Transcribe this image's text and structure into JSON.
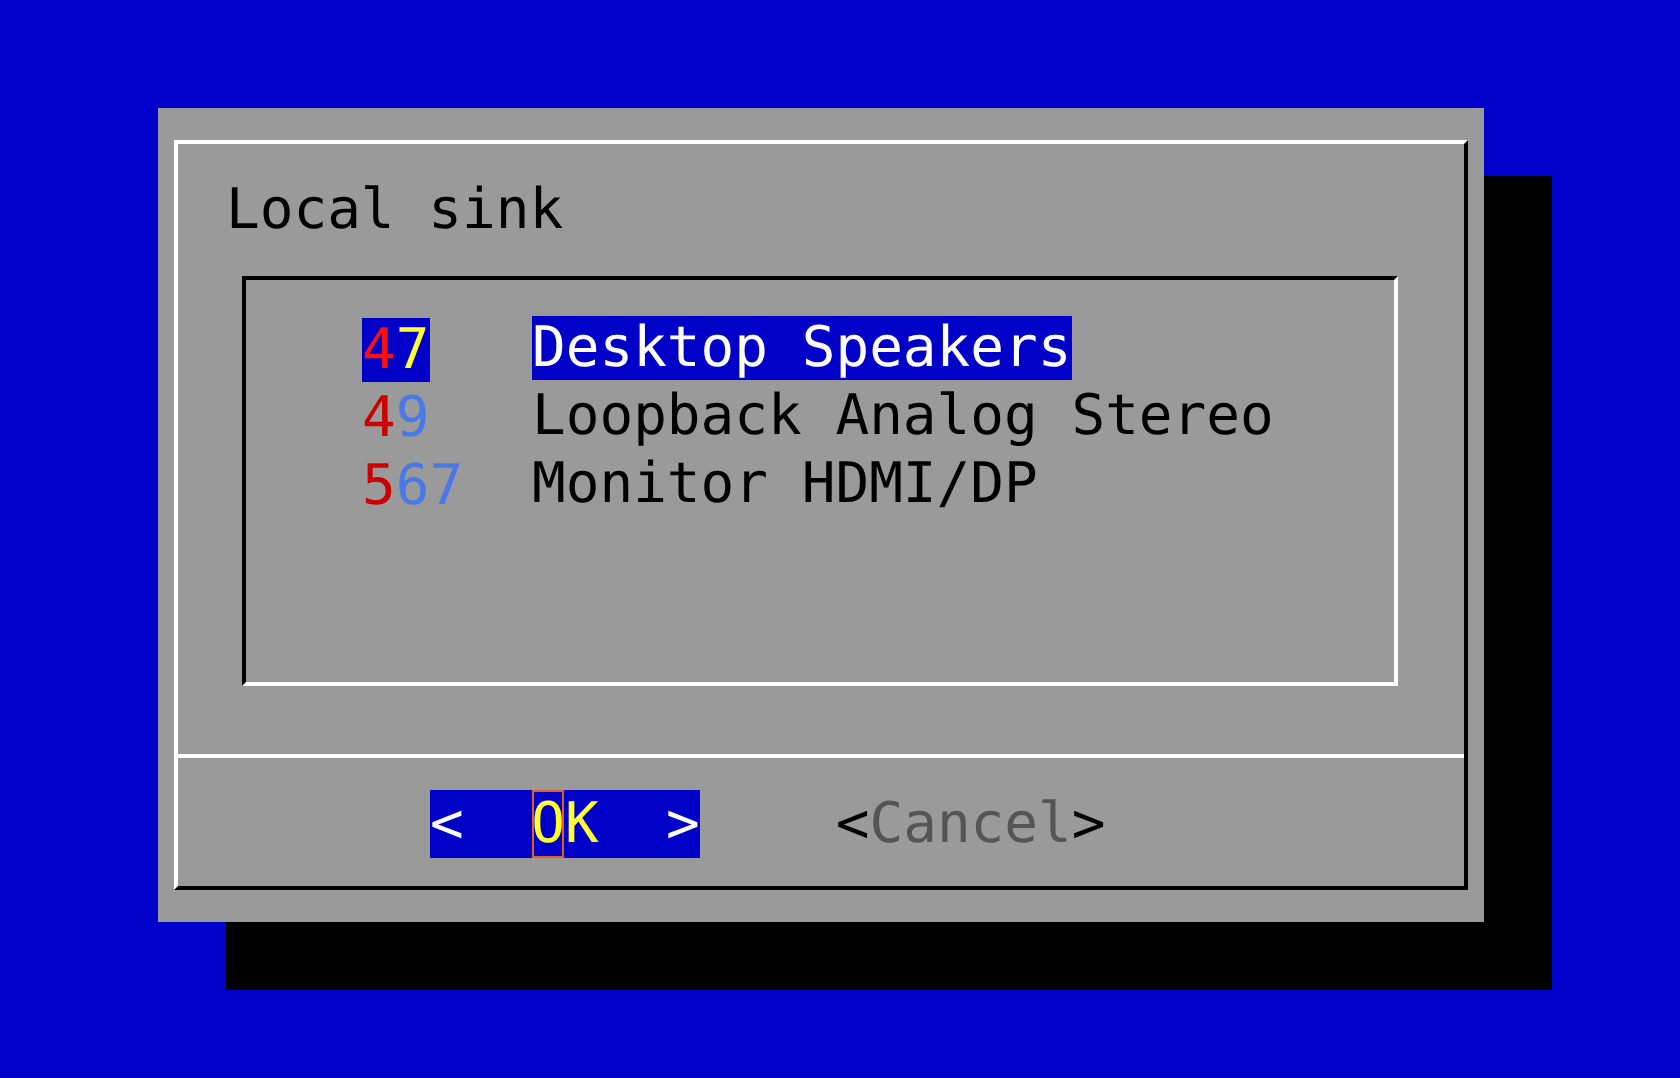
{
  "dialog": {
    "title": "Local sink",
    "items": [
      {
        "tag": "47",
        "description": "Desktop Speakers",
        "selected": true
      },
      {
        "tag": "49",
        "description": "Loopback Analog Stereo",
        "selected": false
      },
      {
        "tag": "567",
        "description": "Monitor HDMI/DP",
        "selected": false
      }
    ],
    "buttons": [
      {
        "open": "<",
        "label": "OK",
        "close": ">",
        "selected": true
      },
      {
        "open": "<",
        "label": "Cancel",
        "close": ">",
        "selected": false
      }
    ]
  }
}
